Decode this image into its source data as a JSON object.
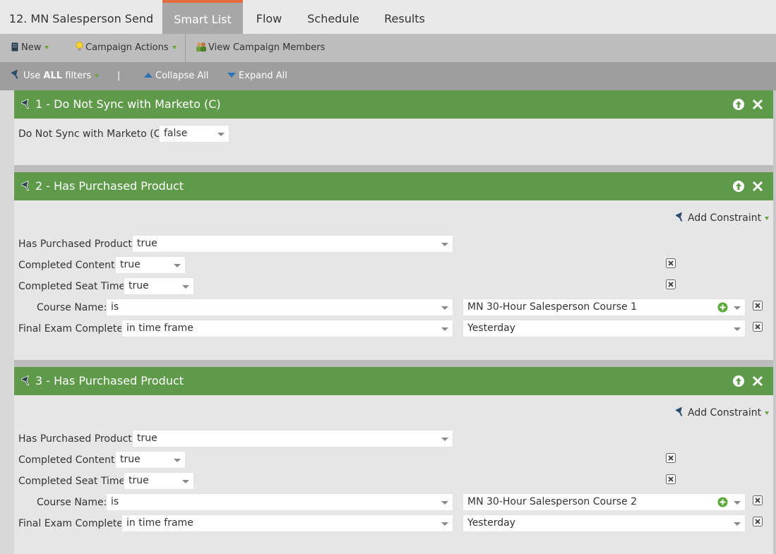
{
  "tabs": [
    {
      "label": "12. MN Salesperson Send",
      "active": false
    },
    {
      "label": "Smart List",
      "active": true
    },
    {
      "label": "Flow",
      "active": false
    },
    {
      "label": "Schedule",
      "active": false
    },
    {
      "label": "Results",
      "active": false
    }
  ],
  "toolbar": {
    "new_label": "New",
    "campaign_actions_label": "Campaign Actions",
    "view_members_label": "View Campaign Members"
  },
  "filterbar": {
    "use_prefix": "Use ",
    "use_bold": "ALL",
    "use_suffix": " filters",
    "separator": "|",
    "collapse_label": "Collapse All",
    "expand_label": "Expand All"
  },
  "filters": [
    {
      "title": "1 - Do Not Sync with Marketo (C)",
      "fields": [
        {
          "label": "Do Not Sync with Marketo (C):",
          "value": "false"
        }
      ]
    },
    {
      "title": "2 - Has Purchased Product",
      "add_constraint": "Add Constraint",
      "fields": [
        {
          "label": "Has Purchased Product:",
          "value": "true"
        },
        {
          "label": "Completed Content:",
          "value": "true"
        },
        {
          "label": "Completed Seat Time:",
          "value": "true"
        },
        {
          "label": "Course Name:",
          "operator": "is",
          "value": "MN 30-Hour Salesperson Course 1"
        },
        {
          "label": "Final Exam Complete:",
          "operator": "in time frame",
          "value": "Yesterday"
        }
      ]
    },
    {
      "title": "3 - Has Purchased Product",
      "add_constraint": "Add Constraint",
      "fields": [
        {
          "label": "Has Purchased Product:",
          "value": "true"
        },
        {
          "label": "Completed Content:",
          "value": "true"
        },
        {
          "label": "Completed Seat Time:",
          "value": "true"
        },
        {
          "label": "Course Name:",
          "operator": "is",
          "value": "MN 30-Hour Salesperson Course 2"
        },
        {
          "label": "Final Exam Complete:",
          "operator": "in time frame",
          "value": "Yesterday"
        }
      ]
    }
  ],
  "colors": {
    "header_green": "#5f9a4a",
    "active_tab_accent": "#e46d3d",
    "link_blue": "#2a72b5"
  }
}
